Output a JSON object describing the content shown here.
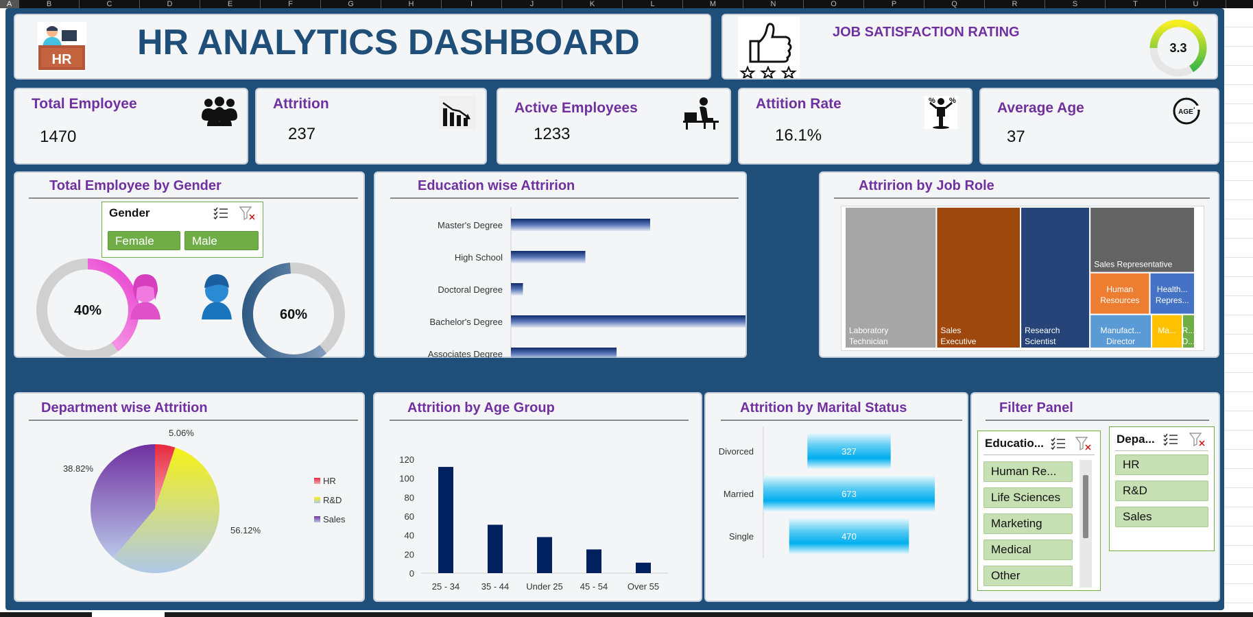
{
  "sheet": {
    "columns": [
      "A",
      "B",
      "C",
      "D",
      "E",
      "F",
      "G",
      "H",
      "I",
      "J",
      "K",
      "L",
      "M",
      "N",
      "O",
      "P",
      "Q",
      "R",
      "S",
      "T",
      "U"
    ]
  },
  "header": {
    "logo_text": "HR",
    "title": "HR ANALYTICS DASHBOARD",
    "job_satisfaction_label": "JOB SATISFACTION RATING",
    "job_satisfaction_value": "3.3",
    "job_satisfaction_fraction": 0.66
  },
  "kpis": [
    {
      "label": "Total Employee",
      "value": "1470",
      "icon": "people-group-icon"
    },
    {
      "label": "Attrition",
      "value": "237",
      "icon": "declining-bar-icon"
    },
    {
      "label": "Active Employees",
      "value": "1233",
      "icon": "person-at-desk-icon"
    },
    {
      "label": "Attition Rate",
      "value": "16.1%",
      "icon": "percent-person-icon"
    },
    {
      "label": "Average Age",
      "value": "37",
      "icon": "age-cycle-icon"
    }
  ],
  "gender_card": {
    "title": "Total Employee by Gender",
    "slicer_title": "Gender",
    "slicer_items": [
      "Female",
      "Male"
    ],
    "female_pct": "40%",
    "male_pct": "60%",
    "female_color": "#e83fd0",
    "male_color": "#1f4e79"
  },
  "education_card": {
    "title": "Education wise Attririon"
  },
  "jobrole_card": {
    "title": "Attririon by Job Role"
  },
  "department_card": {
    "title": "Department wise Attrition"
  },
  "age_card": {
    "title": "Attrition by Age Group"
  },
  "marital_card": {
    "title": "Attrition by Marital Status"
  },
  "filter_card": {
    "title": "Filter Panel",
    "education_slicer_title": "Educatio...",
    "education_items": [
      "Human Re...",
      "Life Sciences",
      "Marketing",
      "Medical",
      "Other"
    ],
    "department_slicer_title": "Depa...",
    "department_items": [
      "HR",
      "R&D",
      "Sales"
    ]
  },
  "chart_data": [
    {
      "type": "bar",
      "orientation": "horizontal",
      "categories": [
        "Master's Degree",
        "High School",
        "Doctoral Degree",
        "Bachelor's Degree",
        "Associates Degree"
      ],
      "values": [
        58,
        31,
        5,
        99,
        44
      ],
      "colors": {
        "bar": "#1f3c7a"
      }
    },
    {
      "type": "treemap",
      "items": [
        {
          "label": "Laboratory Technician",
          "value": 62,
          "color": "#a6a6a6"
        },
        {
          "label": "Sales Executive",
          "value": 57,
          "color": "#9e480e"
        },
        {
          "label": "Research Scientist",
          "value": 47,
          "color": "#264478"
        },
        {
          "label": "Sales Representative",
          "value": 33,
          "color": "#636363"
        },
        {
          "label": "Human Resources",
          "value": 12,
          "color": "#ed7d31"
        },
        {
          "label": "Health... Repres...",
          "value": 9,
          "color": "#4472c4"
        },
        {
          "label": "Manufact... Director",
          "value": 10,
          "color": "#5b9bd5"
        },
        {
          "label": "Ma...",
          "value": 5,
          "color": "#ffc000"
        },
        {
          "label": "R... D...",
          "value": 2,
          "color": "#70ad47"
        }
      ]
    },
    {
      "type": "pie",
      "labels": [
        "HR",
        "R&D",
        "Sales"
      ],
      "values": [
        5.06,
        56.12,
        38.82
      ],
      "data_labels": [
        "5.06%",
        "56.12%",
        "38.82%"
      ],
      "colors": [
        "#e8283e",
        "#f5f218",
        "#7030a0"
      ],
      "legend_position": "right"
    },
    {
      "type": "bar",
      "categories": [
        "25 - 34",
        "35 - 44",
        "Under 25",
        "45 - 54",
        "Over 55"
      ],
      "values": [
        112,
        51,
        38,
        25,
        11
      ],
      "ylim": [
        0,
        120
      ],
      "yticks": [
        0,
        20,
        40,
        60,
        80,
        100,
        120
      ],
      "colors": {
        "bar": "#002060"
      }
    },
    {
      "type": "bar",
      "orientation": "horizontal",
      "style": "funnel",
      "categories": [
        "Divorced",
        "Married",
        "Single"
      ],
      "values": [
        327,
        673,
        470
      ],
      "data_labels": [
        "327",
        "673",
        "470"
      ],
      "colors": {
        "bar": "#00b0f0"
      }
    }
  ]
}
